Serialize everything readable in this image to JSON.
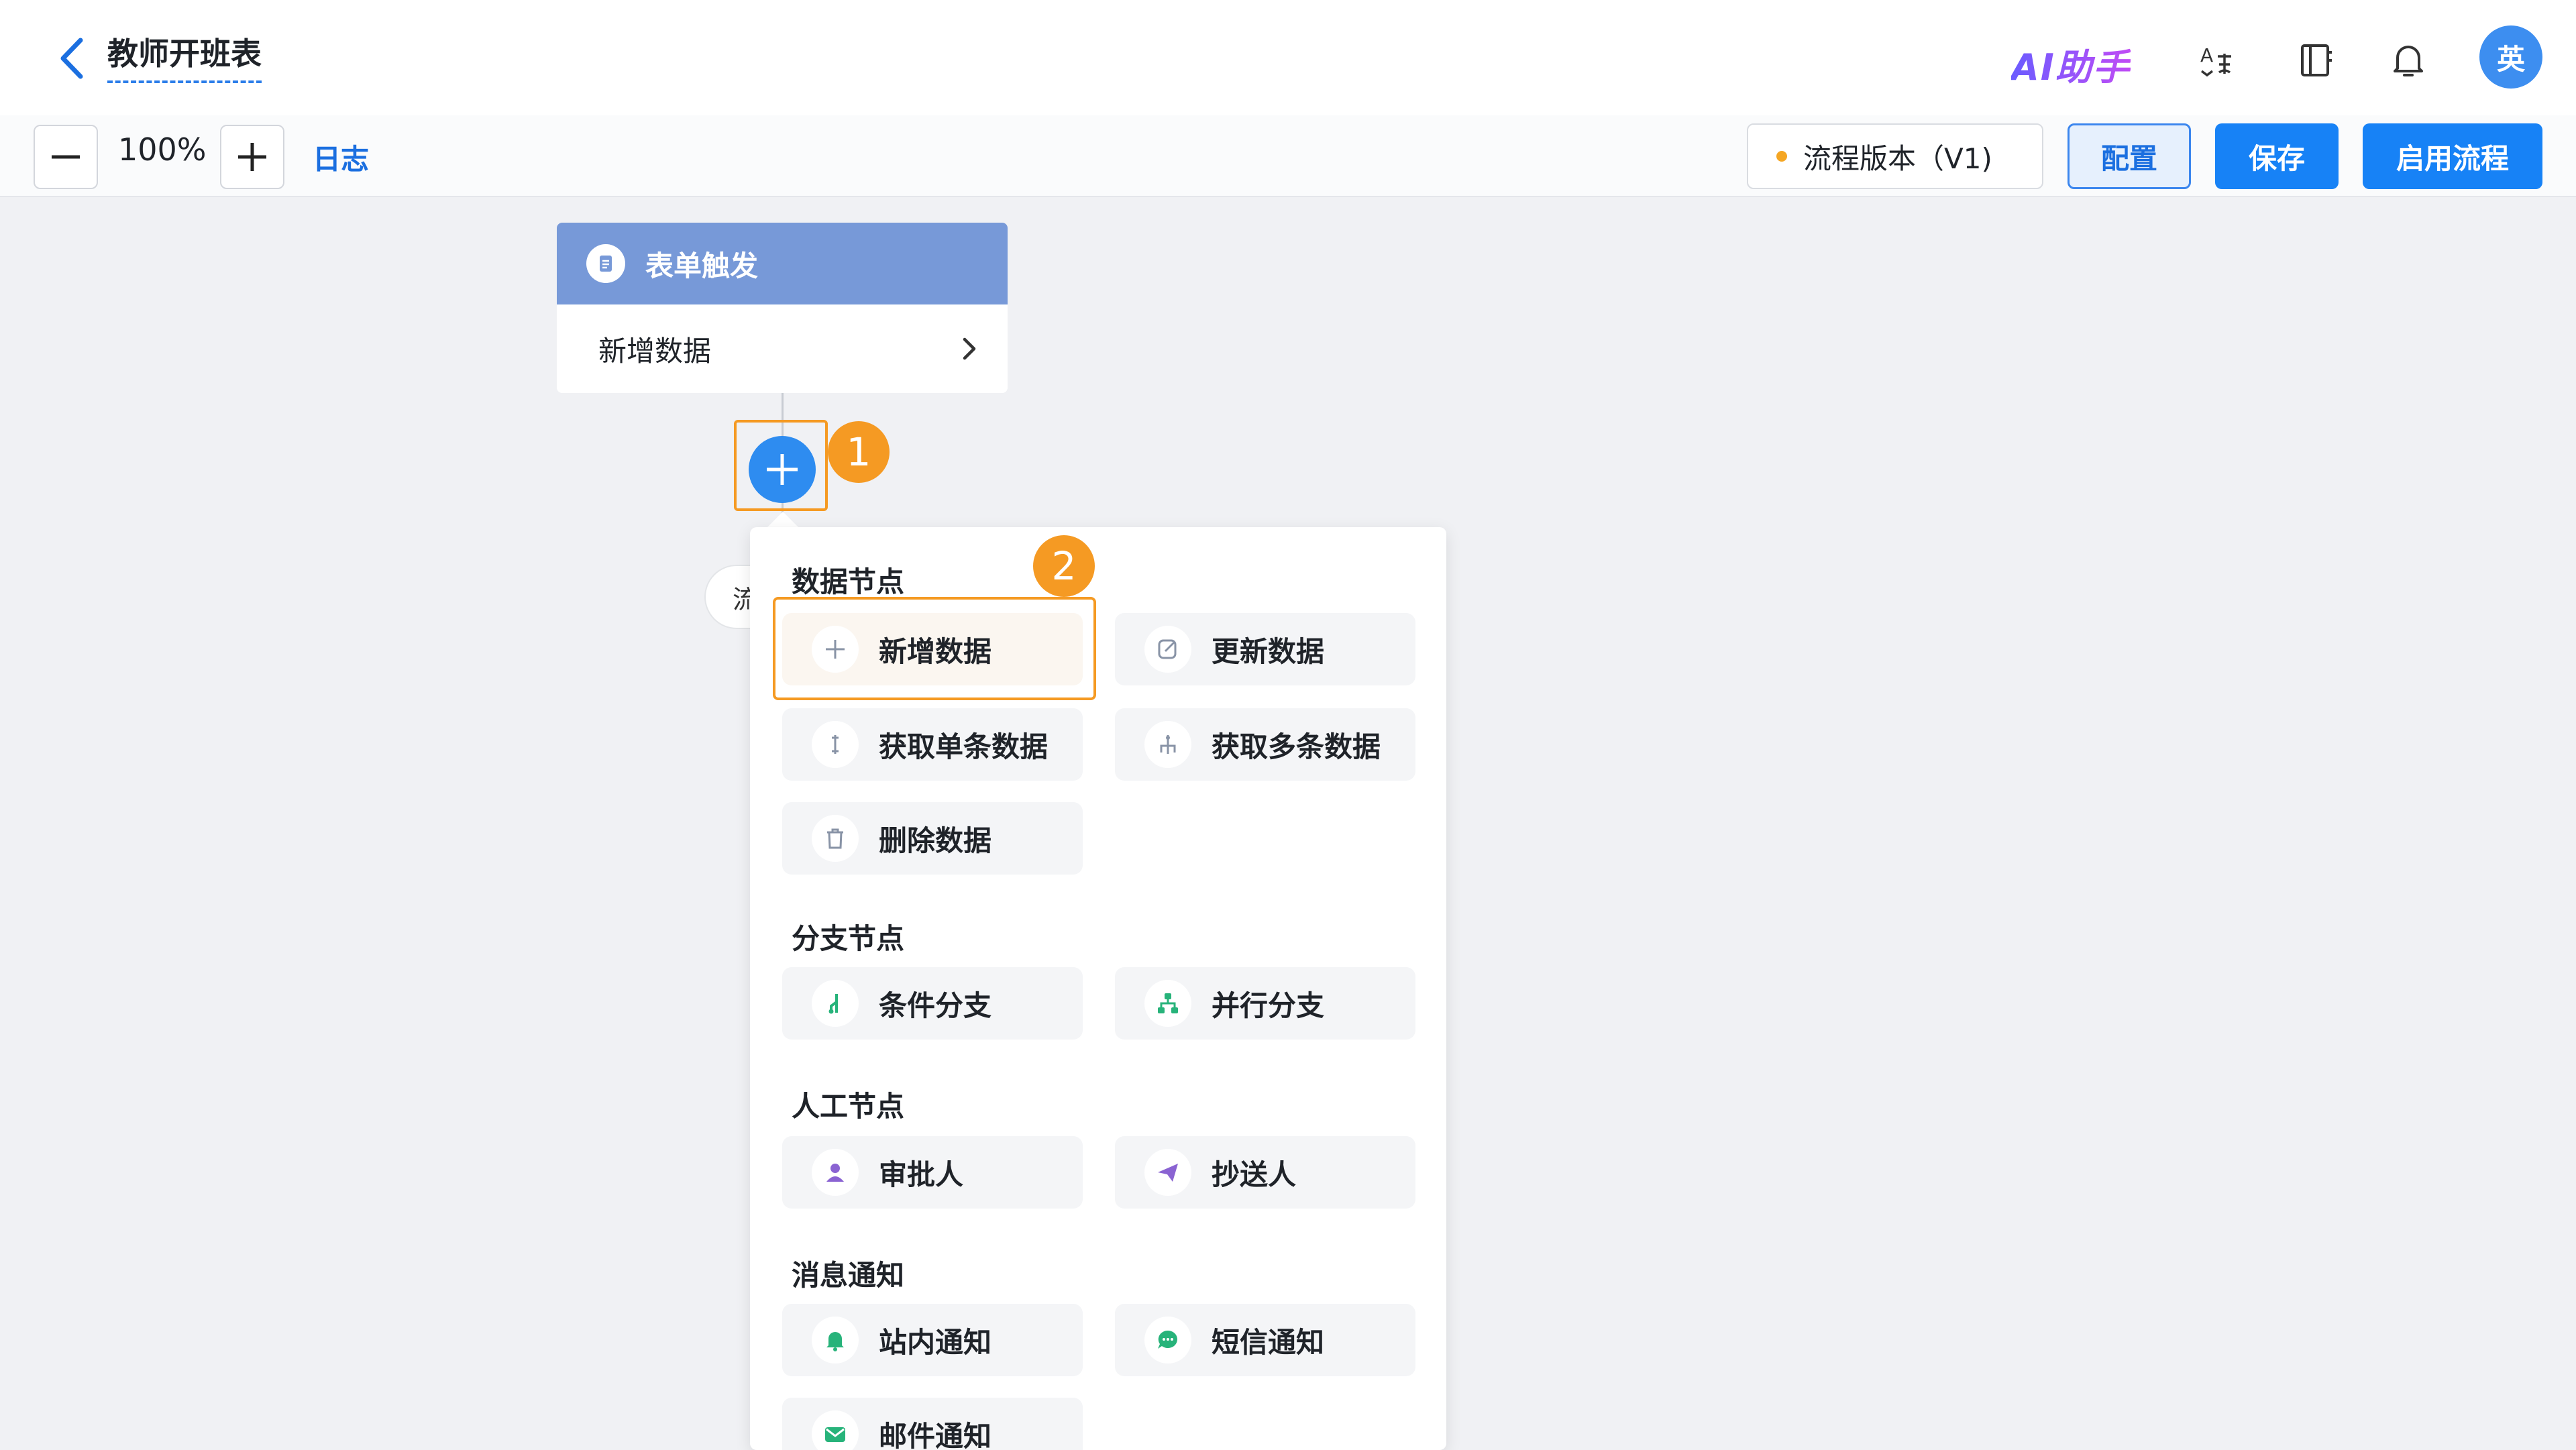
{
  "header": {
    "title": "教师开班表",
    "ai_brand": "AI助手",
    "avatar_text": "英"
  },
  "toolbar": {
    "zoom_level": "100%",
    "log_label": "日志",
    "version_label": "流程版本（V1)",
    "config_label": "配置",
    "save_label": "保存",
    "enable_label": "启用流程"
  },
  "canvas": {
    "trigger_title": "表单触发",
    "trigger_action": "新增数据",
    "hidden_node_text": "流",
    "step1": "1",
    "step2": "2"
  },
  "menu": {
    "sections": [
      {
        "title": "数据节点",
        "items": [
          "新增数据",
          "更新数据",
          "获取单条数据",
          "获取多条数据",
          "删除数据"
        ]
      },
      {
        "title": "分支节点",
        "items": [
          "条件分支",
          "并行分支"
        ]
      },
      {
        "title": "人工节点",
        "items": [
          "审批人",
          "抄送人"
        ]
      },
      {
        "title": "消息通知",
        "items": [
          "站内通知",
          "短信通知",
          "邮件通知"
        ]
      }
    ]
  },
  "colors": {
    "accent": "#1782f6",
    "highlight": "#f59a23",
    "trigger_header": "#7799d8",
    "branch_icon": "#27b37a",
    "person_icon": "#8a63d2"
  },
  "icons": [
    "chevron-left-icon",
    "translate-icon",
    "book-icon",
    "bell-icon",
    "minus-icon",
    "plus-icon",
    "document-icon",
    "chevron-right-icon",
    "plus-icon",
    "edit-icon",
    "single-data-icon",
    "multi-data-icon",
    "trash-icon",
    "condition-branch-icon",
    "parallel-branch-icon",
    "approver-icon",
    "send-icon",
    "bell-icon",
    "chat-icon",
    "mail-icon"
  ]
}
